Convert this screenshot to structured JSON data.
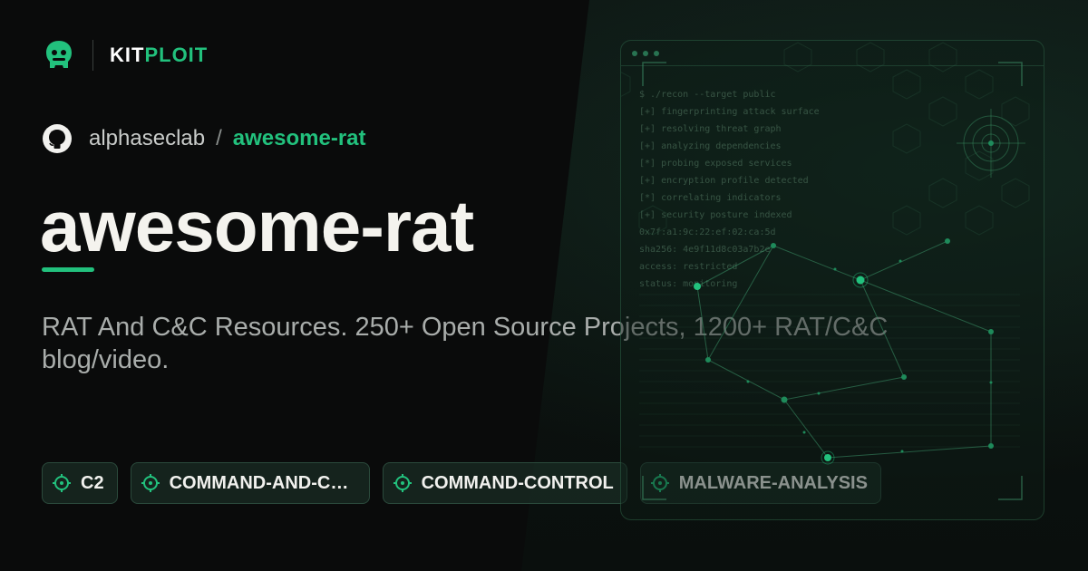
{
  "brand": {
    "name_part1": "KIT",
    "name_part2": "PLOIT",
    "logo_icon": "kitploit-logo-icon"
  },
  "repo": {
    "owner": "alphaseclab",
    "separator": "/",
    "name": "awesome-rat",
    "icon": "github-icon"
  },
  "title": "awesome-rat",
  "description": "RAT And C&C Resources. 250+ Open Source Projects, 1200+ RAT/C&C blog/video.",
  "tags": [
    {
      "label": "C2",
      "icon": "crosshair-icon"
    },
    {
      "label": "COMMAND-AND-CO...",
      "icon": "crosshair-icon"
    },
    {
      "label": "COMMAND-CONTROL",
      "icon": "crosshair-icon"
    },
    {
      "label": "MALWARE-ANALYSIS",
      "icon": "crosshair-icon"
    }
  ],
  "terminal": {
    "lines": [
      "$ ./recon --target public",
      "[+] fingerprinting attack surface",
      "[+] resolving threat graph",
      "[+] analyzing dependencies",
      "[*] probing exposed services",
      "[+] encryption profile detected",
      "[*] correlating indicators",
      "[+] security posture indexed",
      "0x7f:a1:9c:22:ef:02:ca:5d",
      "sha256: 4e9f11d8c03a7b2e",
      "access: restricted",
      "status: monitoring"
    ]
  },
  "colors": {
    "accent": "#22c17d",
    "background": "#0a0b0b",
    "text": "#f4f3ee"
  }
}
